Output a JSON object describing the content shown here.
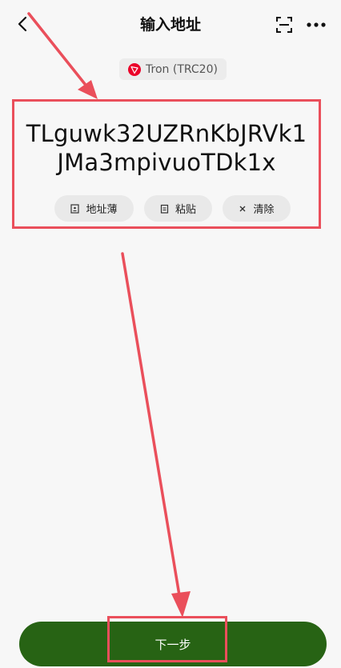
{
  "header": {
    "title": "输入地址"
  },
  "network": {
    "label": "Tron (TRC20)",
    "accent": "#eb0029"
  },
  "address": {
    "line1": "TLguwk32UZRnKbJRVk1",
    "line2": "JMa3mpivuoTDk1x"
  },
  "actions": {
    "address_book": "地址薄",
    "paste": "粘贴",
    "clear": "清除"
  },
  "footer": {
    "next_label": "下一步",
    "button_color": "#276314"
  },
  "annotation_color": "#ea4f5b"
}
